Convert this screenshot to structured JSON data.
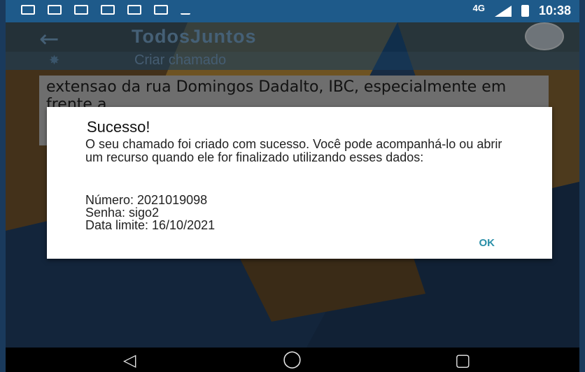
{
  "status_bar": {
    "network": "4G",
    "time": "10:38"
  },
  "app_bar": {
    "title": "TodosJuntos"
  },
  "sub_bar": {
    "label": "Criar chamado"
  },
  "background_text": "extensao da rua Domingos Dadalto, IBC, especialmente em frente a",
  "dialog": {
    "title": "Sucesso!",
    "message": "O seu chamado foi criado com sucesso. Você pode acompanhá-lo ou abrir um recurso quando ele for finalizado utilizando esses dados:",
    "number_line": "Número: 2021019098",
    "password_line": "Senha: sigo2",
    "deadline_line": "Data limite: 16/10/2021",
    "ok_label": "OK"
  },
  "colors": {
    "accent": "#2a8fa8",
    "status_bar": "#1e5a8a"
  },
  "icons": [
    "back-arrow-icon",
    "gear-icon",
    "back-nav-icon",
    "home-nav-icon",
    "recents-nav-icon"
  ]
}
